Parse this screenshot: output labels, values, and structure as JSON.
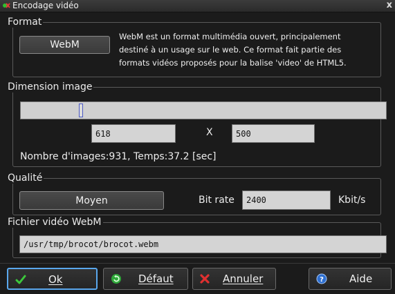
{
  "window": {
    "title": "Encodage vidéo",
    "close_glyph": "x"
  },
  "format": {
    "legend": "Format",
    "button_label": "WebM",
    "description_lines": [
      "WebM est un format multimédia ouvert, principalement",
      "destiné à un usage sur le web. Ce format fait partie des",
      "formats vidéos proposés pour la balise 'video' de HTML5."
    ]
  },
  "dimension": {
    "legend": "Dimension image",
    "slider_value_fraction": 0.16,
    "width_value": "618",
    "separator": "X",
    "height_value": "500",
    "summary": "Nombre d'images:931, Temps:37.2 [sec]"
  },
  "quality": {
    "legend": "Qualité",
    "button_label": "Moyen",
    "bitrate_label": "Bit rate",
    "bitrate_value": "2400",
    "unit": "Kbit/s"
  },
  "file": {
    "legend": "Fichier vidéo WebM",
    "path": "/usr/tmp/brocot/brocot.webm"
  },
  "buttons": {
    "ok": {
      "label": "Ok",
      "icon": "checkmark-icon"
    },
    "default": {
      "label": "Défaut",
      "icon": "reset-icon"
    },
    "cancel": {
      "label": "Annuler",
      "icon": "cross-icon"
    },
    "help": {
      "label": "Aide",
      "icon": "help-icon"
    }
  },
  "colors": {
    "accent_focus": "#5aa8ee",
    "ok_icon": "#3cc83c",
    "cancel_icon": "#e03030",
    "help_icon": "#2e6fd0"
  }
}
